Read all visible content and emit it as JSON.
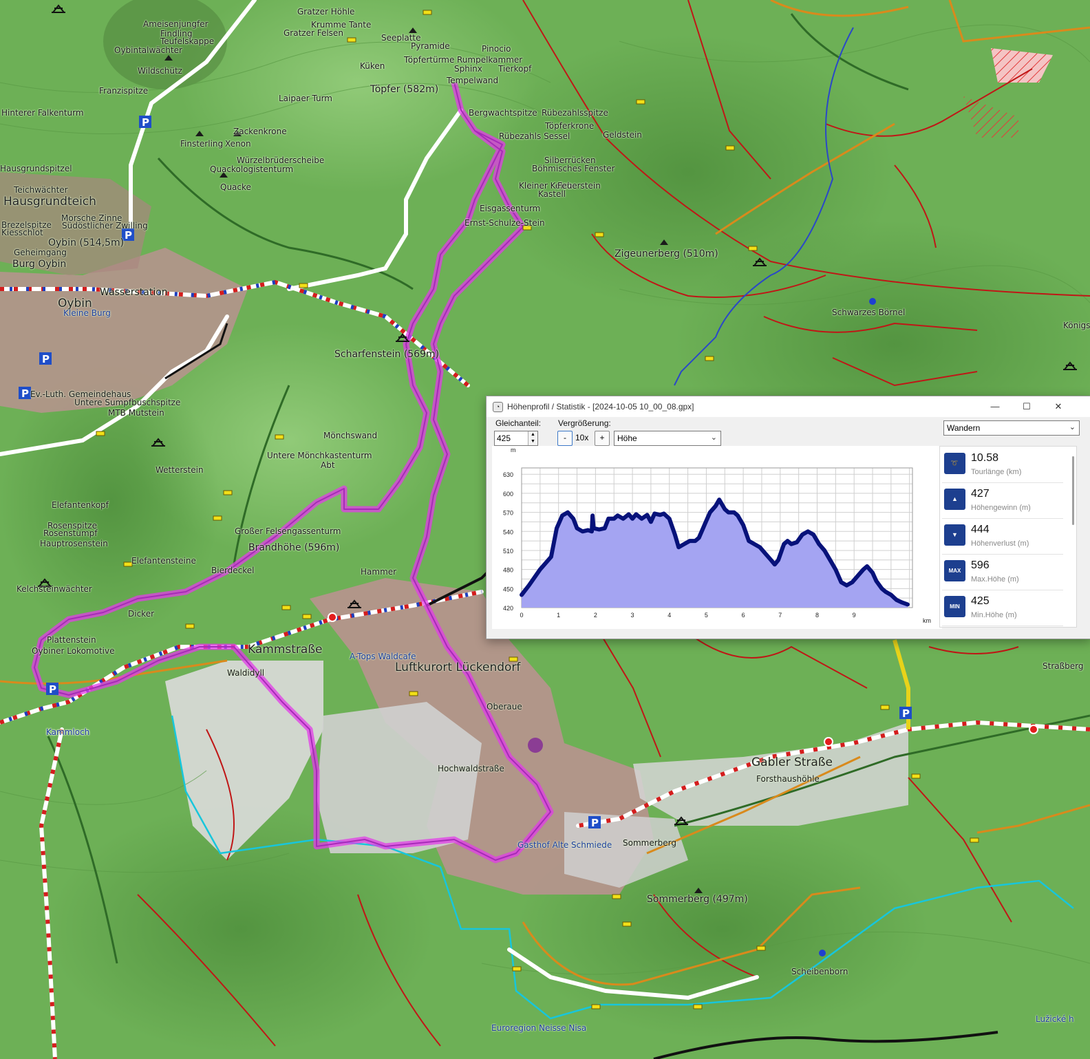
{
  "map": {
    "labels": [
      "Gratzer Höhle",
      "Ameisenjungfer",
      "Findling",
      "Teufelskappe",
      "Oybintalwächter",
      "Krumme Tante",
      "Gratzer Felsen",
      "Seeplatte",
      "Pyramide",
      "Pinocio",
      "Töpfertürme",
      "Rumpelkammer",
      "Sphinx",
      "Tierkopf",
      "Küken",
      "Tempelwand",
      "Töpfer (582m)",
      "Wildschütz",
      "Franzispitze",
      "Laipaer Turm",
      "Bergwachtspitze",
      "Rübezahlsspitze",
      "Töpferkrone",
      "Geldstein",
      "Rübezahls Sessel",
      "Silberrücken",
      "Böhmisches Fenster",
      "Kleiner Kelch",
      "Feuerstein",
      "Kastell",
      "Hinterer Falkenturm",
      "Zackenkrone",
      "Finsterling",
      "Xenon",
      "Würzelbrüderscheibe",
      "Quackologistenturm",
      "Quacke",
      "Hausgrundspitzel",
      "Teichwächter",
      "Hausgrundteich",
      "Eisgassenturm",
      "Ernst-Schulze-Stein",
      "Zigeunerberg (510m)",
      "Morsche Zinne",
      "Südöstlicher Zwilling",
      "Brezelspitze",
      "Kiesschlot",
      "Oybin (514,5m)",
      "Geheimgang",
      "Burg Oybin",
      "Wasserstation",
      "Oybin",
      "Kleine Burg",
      "Schwarzes Börnel",
      "Scharfenstein (569m)",
      "Ev.-Luth. Gemeindehaus",
      "Untere Sumpfbuschspitze",
      "MTB Mutstein",
      "Mönchswand",
      "Untere Mönchkastenturm",
      "Wetterstein",
      "Elefantenkopf",
      "Rosenspitze",
      "Rosenstumpf",
      "Hauptrosenstein",
      "Großer Felsengassenturm",
      "Brandhöhe (596m)",
      "Elefantensteine",
      "Bierdeckel",
      "Hammer",
      "Kelchsteinwächter",
      "Dicker",
      "Plattenstein",
      "Oybiner Lokomotive",
      "Kammstraße",
      "A-Tops Waldcafe",
      "Luftkurort Lückendorf",
      "Waldidyll",
      "Kammloch",
      "Oberaue",
      "Hochwaldstraße",
      "Gabler Straße",
      "Forsthaushöhle",
      "Gasthof Alte Schmiede",
      "Sommerberg",
      "Sommerberg (497m)",
      "Scheibenborn",
      "Euroregion Neisse Nisa",
      "Straßberg",
      "Lužické h",
      "Kammloch",
      "Königs",
      "Abt"
    ]
  },
  "dialog": {
    "title": "Höhenprofil / Statistik - [2024-10-05 10_00_08.gpx]",
    "controls": {
      "window_minimize": "—",
      "window_maximize": "☐",
      "window_close": "✕",
      "offset_label": "Gleichanteil:",
      "offset_value": "425",
      "zoom_label": "Vergrößerung:",
      "zoom_minus": "-",
      "zoom_value": "10x",
      "zoom_plus": "+",
      "mode_select": "Höhe",
      "activity_select": "Wandern"
    },
    "stats": [
      {
        "icon": "route-icon",
        "value": "10.58",
        "label": "Tourlänge (km)"
      },
      {
        "icon": "ascent-icon",
        "value": "427",
        "label": "Höhengewinn (m)"
      },
      {
        "icon": "descent-icon",
        "value": "444",
        "label": "Höhenverlust (m)"
      },
      {
        "icon": "max-icon",
        "value": "596",
        "label": "Max.Höhe (m)",
        "badge": "MAX"
      },
      {
        "icon": "min-icon",
        "value": "425",
        "label": "Min.Höhe (m)",
        "badge": "MIN"
      }
    ]
  },
  "chart_data": {
    "type": "area",
    "title": "",
    "xlabel": "km",
    "ylabel": "m",
    "xlim": [
      0,
      10.58
    ],
    "ylim": [
      420,
      650
    ],
    "x_ticks": [
      0,
      1,
      2,
      3,
      4,
      5,
      6,
      7,
      8,
      9
    ],
    "y_ticks": [
      420,
      450,
      480,
      510,
      540,
      570,
      600,
      630
    ],
    "grid": true,
    "colors": {
      "line": "#07127a",
      "fill": "#a4a4f2"
    },
    "x": [
      0,
      0.2,
      0.5,
      0.8,
      0.95,
      1.1,
      1.25,
      1.4,
      1.5,
      1.65,
      1.8,
      1.9,
      1.92,
      1.95,
      2.1,
      2.25,
      2.35,
      2.5,
      2.6,
      2.75,
      2.9,
      3.0,
      3.1,
      3.25,
      3.4,
      3.5,
      3.6,
      3.75,
      3.85,
      4.0,
      4.15,
      4.25,
      4.4,
      4.55,
      4.7,
      4.8,
      4.95,
      5.1,
      5.25,
      5.35,
      5.5,
      5.6,
      5.75,
      5.85,
      6.0,
      6.15,
      6.3,
      6.45,
      6.6,
      6.75,
      6.85,
      6.95,
      7.1,
      7.2,
      7.3,
      7.45,
      7.6,
      7.75,
      7.9,
      8.05,
      8.2,
      8.35,
      8.5,
      8.65,
      8.8,
      8.95,
      9.1,
      9.25,
      9.35,
      9.5,
      9.6,
      9.75,
      9.85,
      10.0,
      10.15,
      10.3,
      10.45
    ],
    "values": [
      440,
      455,
      480,
      500,
      545,
      565,
      570,
      560,
      545,
      540,
      542,
      540,
      565,
      545,
      543,
      545,
      560,
      560,
      565,
      560,
      567,
      560,
      567,
      560,
      566,
      555,
      568,
      566,
      568,
      560,
      535,
      515,
      520,
      525,
      525,
      530,
      550,
      570,
      580,
      590,
      575,
      570,
      570,
      565,
      550,
      525,
      520,
      515,
      505,
      495,
      488,
      495,
      520,
      525,
      520,
      523,
      535,
      540,
      535,
      520,
      510,
      495,
      480,
      460,
      455,
      460,
      470,
      480,
      485,
      475,
      462,
      450,
      445,
      440,
      432,
      428,
      425
    ]
  }
}
